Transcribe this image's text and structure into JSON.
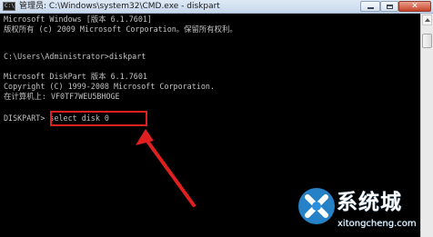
{
  "window": {
    "title": "管理员: C:\\Windows\\system32\\CMD.exe - diskpart",
    "icon": "cmd-icon",
    "app_icon_text": "C:\\"
  },
  "console": {
    "lines": [
      "Microsoft Windows [版本 6.1.7601]",
      "版权所有 (c) 2009 Microsoft Corporation。保留所有权利。",
      "",
      "C:\\Users\\Administrator>diskpart",
      "",
      "Microsoft DiskPart 版本 6.1.7601",
      "Copyright (C) 1999-2008 Microsoft Corporation.",
      "在计算机上: VF0TF7WEU5BHOGE",
      "",
      "DISKPART> select disk 0"
    ],
    "prompt": "DISKPART>",
    "command": "select disk 0"
  },
  "annotation": {
    "highlight_color": "#e02020"
  },
  "watermark": {
    "title": "系统城",
    "url": "xitongcheng.com",
    "brand_color": "#2a8fdc"
  }
}
